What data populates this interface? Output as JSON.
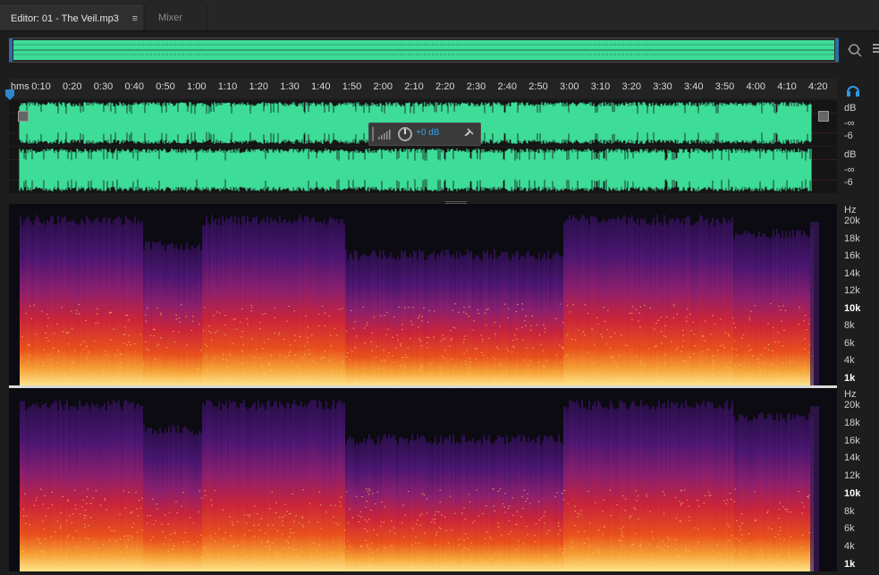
{
  "tabs": {
    "editor_label": "Editor: 01 - The Veil.mp3",
    "editor_menu_icon": "menu-lines-icon",
    "mixer_label": "Mixer"
  },
  "overview": {
    "zoom_icon": "zoom-icon"
  },
  "ruler": {
    "unit": "hms",
    "ticks": [
      "0:10",
      "0:20",
      "0:30",
      "0:40",
      "0:50",
      "1:00",
      "1:10",
      "1:20",
      "1:30",
      "1:40",
      "1:50",
      "2:00",
      "2:10",
      "2:20",
      "2:30",
      "2:40",
      "2:50",
      "3:00",
      "3:10",
      "3:20",
      "3:30",
      "3:40",
      "3:50",
      "4:00",
      "4:10",
      "4:20"
    ]
  },
  "hud": {
    "volume": "+0 dB"
  },
  "db_scale": {
    "left": {
      "unit": "dB",
      "inf": "-∞",
      "minus6": "-6"
    },
    "right": {
      "unit": "dB",
      "inf": "-∞",
      "minus6": "-6"
    }
  },
  "hz_scale": {
    "unit": "Hz",
    "labels": [
      "20k",
      "18k",
      "16k",
      "14k",
      "12k",
      "10k",
      "8k",
      "6k",
      "4k",
      "1k"
    ]
  },
  "colors": {
    "waveform": "#3ddc97",
    "accent": "#38a2e8",
    "background": "#1d1d1d"
  }
}
